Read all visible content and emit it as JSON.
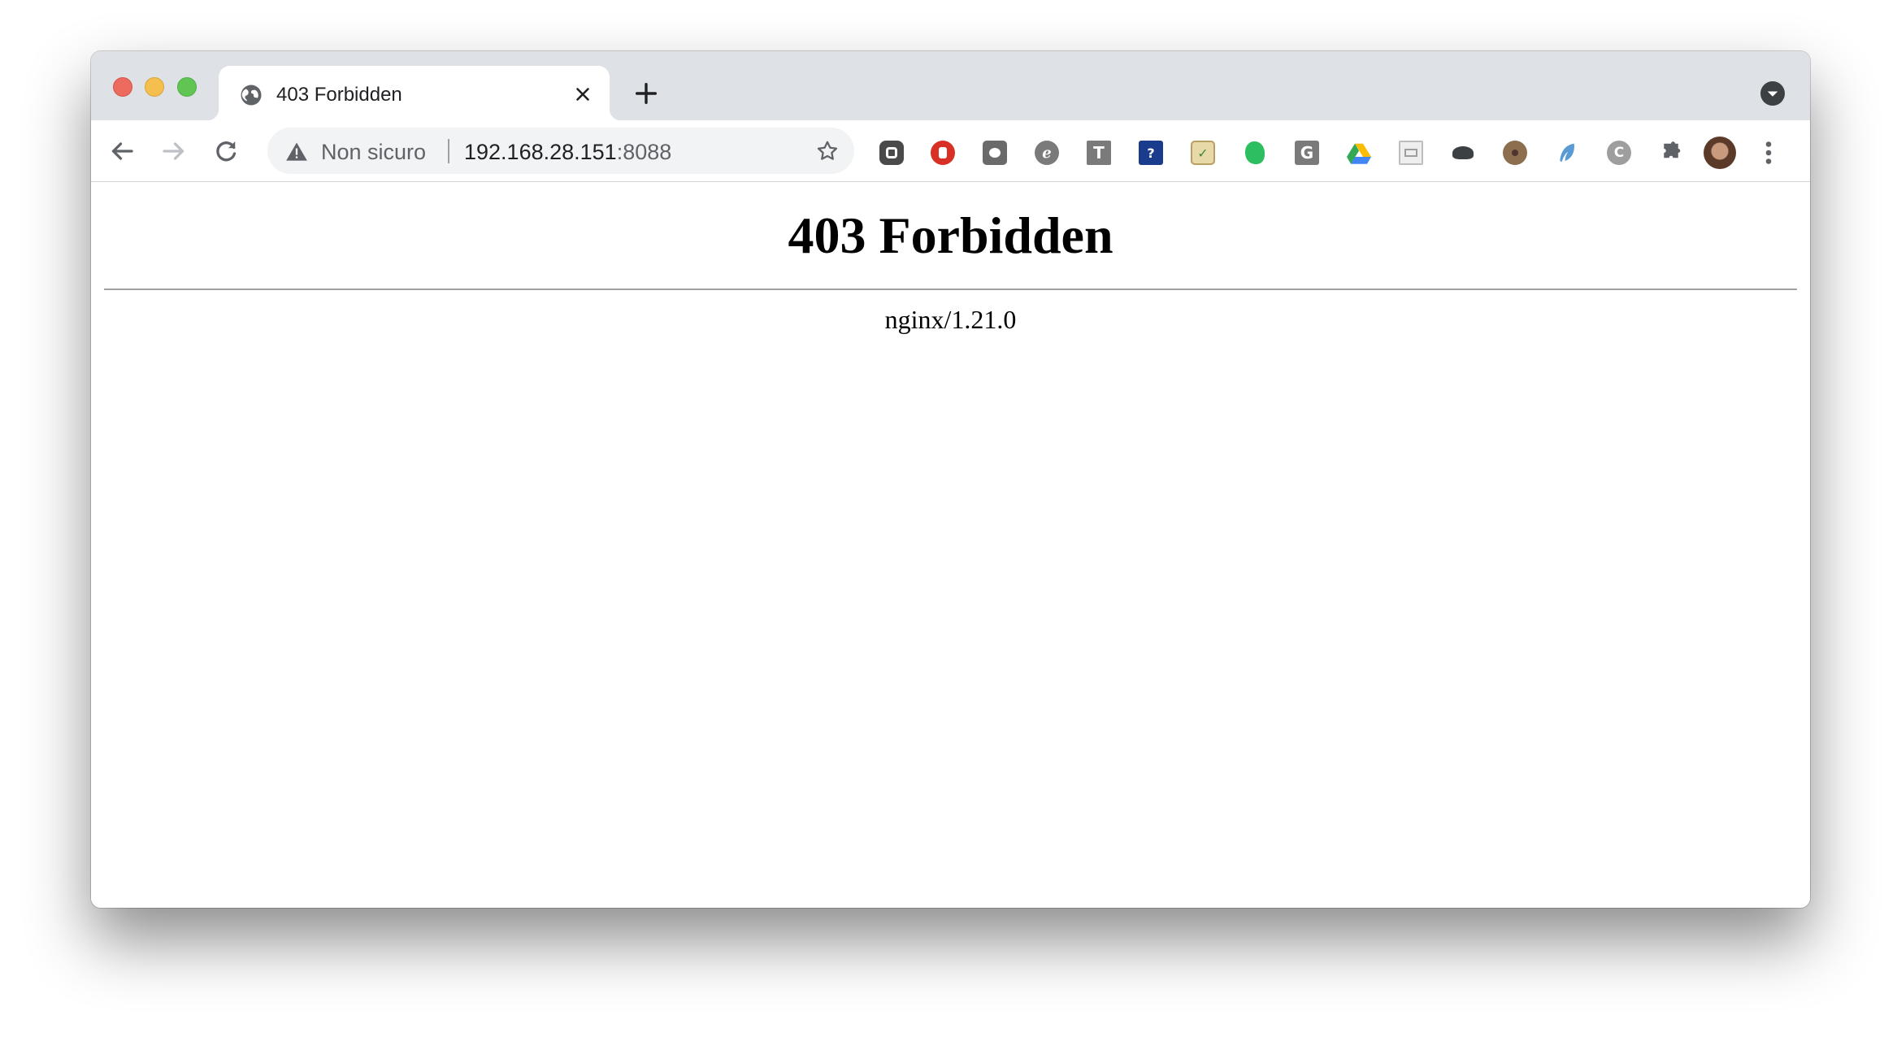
{
  "browser": {
    "tab": {
      "title": "403 Forbidden",
      "favicon": "globe-icon"
    },
    "omnibox": {
      "security_label": "Non sicuro",
      "url_host": "192.168.28.151",
      "url_port": ":8088"
    },
    "extensions": [
      "extension-1-icon",
      "adblock-icon",
      "extension-3-icon",
      "extension-4-icon",
      "extension-t-icon",
      "extension-question-icon",
      "clipboard-icon",
      "evernote-icon",
      "extension-g-icon",
      "google-drive-icon",
      "extension-image-icon",
      "extension-turtle-icon",
      "extension-cookie-icon",
      "extension-feather-icon",
      "extension-c-icon",
      "extensions-puzzle-icon"
    ]
  },
  "page": {
    "heading": "403 Forbidden",
    "server_signature": "nginx/1.21.0"
  },
  "colors": {
    "tabstrip": "#dee1e6",
    "omnibox": "#f1f3f4",
    "close_red": "#ed6a5e",
    "minimize_yellow": "#f4bf4f",
    "zoom_green": "#61c554"
  }
}
